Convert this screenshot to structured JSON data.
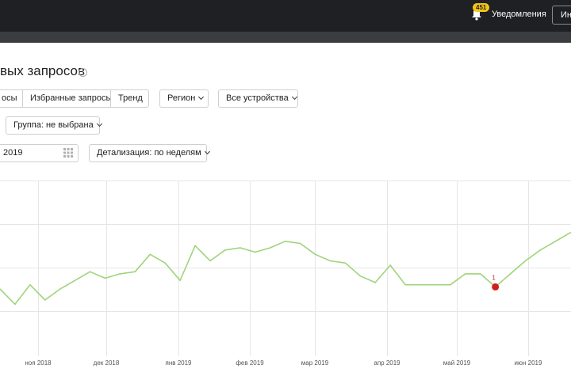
{
  "header": {
    "notifications_count": "451",
    "notifications_label": "Уведомления",
    "button_label": "Ин"
  },
  "page": {
    "title": "вых запросов",
    "info_icon": "info-icon"
  },
  "filters": {
    "tab_partial": "осы",
    "tab_favorites": "Избранные запросы",
    "tab_trend": "Тренд",
    "region": "Регион",
    "devices": "Все устройства",
    "group": "Группа: не выбрана",
    "date_value": "2019",
    "detail": "Детализация: по неделям"
  },
  "chart_data": {
    "type": "line",
    "xlabels": [
      "ноя 2018",
      "дек 2018",
      "янв 2019",
      "фев 2019",
      "мар 2019",
      "апр 2019",
      "май 2019",
      "июн 2019"
    ],
    "series": [
      {
        "color": "#9fd47a",
        "values": [
          60,
          53,
          62,
          55,
          60,
          64,
          68,
          65,
          67,
          68,
          76,
          72,
          64,
          80,
          73,
          78,
          79,
          77,
          79,
          82,
          81,
          76,
          73,
          72,
          66,
          63,
          71,
          62,
          62,
          62,
          62,
          67,
          67,
          61,
          67,
          73,
          78,
          82,
          86
        ]
      }
    ],
    "marker": {
      "index": 33,
      "label": "1",
      "color": "#cc1f1f"
    },
    "ylim": [
      40,
      110
    ],
    "grid": true,
    "legend": "none"
  }
}
